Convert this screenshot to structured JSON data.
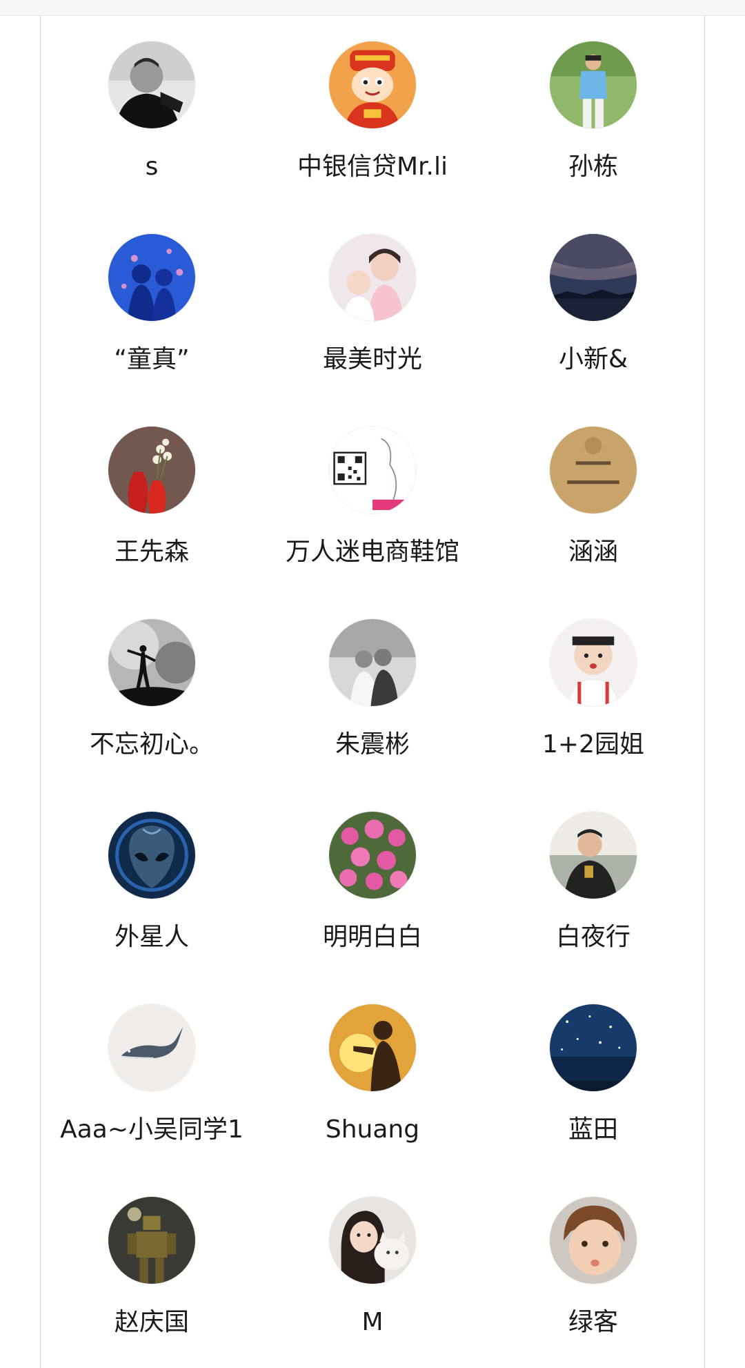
{
  "members": [
    {
      "name": "s",
      "avatar_icon": "portrait-man-bw-icon"
    },
    {
      "name": "中银信贷Mr.li",
      "avatar_icon": "cartoon-fortune-god-icon"
    },
    {
      "name": "孙栋",
      "avatar_icon": "man-outdoors-icon"
    },
    {
      "name": "“童真”",
      "avatar_icon": "children-silhouette-blue-icon"
    },
    {
      "name": "最美时光",
      "avatar_icon": "mother-baby-photo-icon"
    },
    {
      "name": "小新&",
      "avatar_icon": "night-sky-icon"
    },
    {
      "name": "王先森",
      "avatar_icon": "red-vase-flowers-icon"
    },
    {
      "name": "万人迷电商鞋馆",
      "avatar_icon": "qr-code-ad-icon"
    },
    {
      "name": "涵涵",
      "avatar_icon": "calligraphy-badge-icon"
    },
    {
      "name": "不忘初心。",
      "avatar_icon": "silhouette-storm-icon"
    },
    {
      "name": "朱震彬",
      "avatar_icon": "couple-bw-photo-icon"
    },
    {
      "name": "1+2园姐",
      "avatar_icon": "child-headband-icon"
    },
    {
      "name": "外星人",
      "avatar_icon": "alien-head-icon"
    },
    {
      "name": "明明白白",
      "avatar_icon": "pink-flowers-icon"
    },
    {
      "name": "白夜行",
      "avatar_icon": "man-suit-photo-icon"
    },
    {
      "name": "Aaa~小吴同学1",
      "avatar_icon": "whale-icon"
    },
    {
      "name": "Shuang",
      "avatar_icon": "sunset-silhouette-icon"
    },
    {
      "name": "蓝田",
      "avatar_icon": "starry-night-icon"
    },
    {
      "name": "赵庆国",
      "avatar_icon": "robot-figure-icon"
    },
    {
      "name": "M",
      "avatar_icon": "girl-with-cat-icon"
    },
    {
      "name": "绿客",
      "avatar_icon": "child-face-icon"
    }
  ]
}
